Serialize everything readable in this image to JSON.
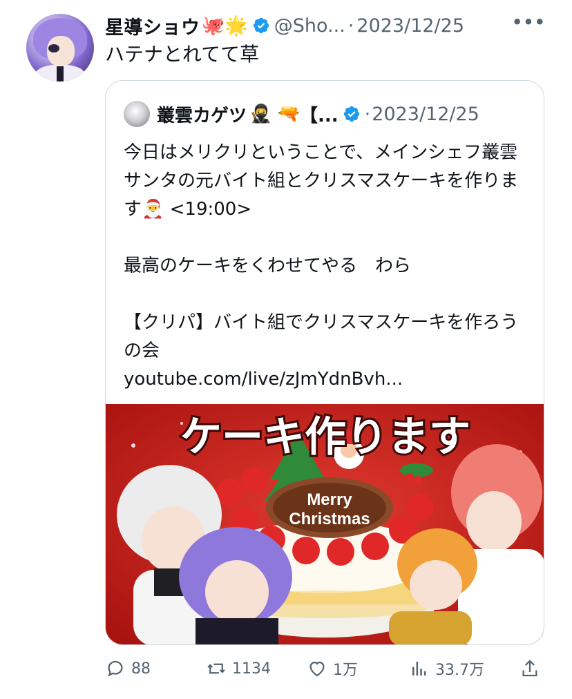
{
  "tweet": {
    "author": {
      "display_name": "星導ショウ",
      "emoji": "🐙🌟",
      "handle": "@Sho...",
      "avatar_icon": "user-avatar-purple-hair"
    },
    "separator": "·",
    "date": "2023/12/25",
    "more_label": "•••",
    "text": "ハテナとれてて草"
  },
  "quote": {
    "author": {
      "display_name": "叢雲カゲツ",
      "emoji": "🥷 🔫",
      "bracket": "【...",
      "avatar_icon": "user-avatar-white-hair"
    },
    "separator": "·",
    "date": "2023/12/25",
    "body": "今日はメリクリということで、メインシェフ叢雲サンタの元バイト組とクリスマスケーキを作ります🎅 <19:00>\n\n最高のケーキをくわせてやる　わら\n\n【クリパ】バイト組でクリスマスケーキを作ろうの会\nyoutube.com/live/zJmYdnBvh...",
    "thumbnail": {
      "title": "ケーキ作ります",
      "plaque_line1": "Merry",
      "plaque_line2": "Christmas"
    }
  },
  "actions": {
    "replies": "88",
    "retweets": "1134",
    "likes": "1万",
    "views": "33.7万"
  },
  "colors": {
    "verified": "#1d9bf0",
    "muted": "#536471",
    "thumbnail_bg": "#c8201d"
  }
}
